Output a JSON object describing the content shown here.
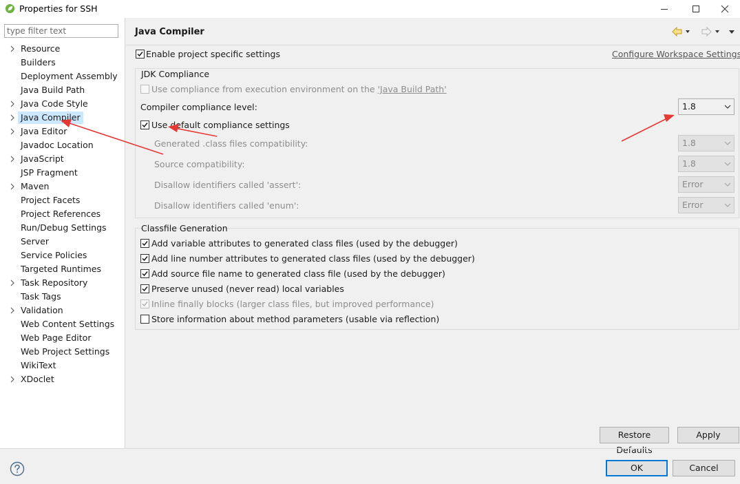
{
  "window": {
    "title": "Properties for SSH",
    "colors": {
      "accent": "#0078d7",
      "selection": "#cce8ff",
      "spring_green": "#6db33f",
      "annotation_red": "#e53935"
    }
  },
  "filter": {
    "placeholder": "type filter text",
    "value": ""
  },
  "tree": [
    {
      "label": "Resource",
      "expandable": true
    },
    {
      "label": "Builders",
      "expandable": false
    },
    {
      "label": "Deployment Assembly",
      "expandable": false
    },
    {
      "label": "Java Build Path",
      "expandable": false
    },
    {
      "label": "Java Code Style",
      "expandable": true
    },
    {
      "label": "Java Compiler",
      "expandable": true,
      "selected": true
    },
    {
      "label": "Java Editor",
      "expandable": true
    },
    {
      "label": "Javadoc Location",
      "expandable": false
    },
    {
      "label": "JavaScript",
      "expandable": true
    },
    {
      "label": "JSP Fragment",
      "expandable": false
    },
    {
      "label": "Maven",
      "expandable": true
    },
    {
      "label": "Project Facets",
      "expandable": false
    },
    {
      "label": "Project References",
      "expandable": false
    },
    {
      "label": "Run/Debug Settings",
      "expandable": false
    },
    {
      "label": "Server",
      "expandable": false
    },
    {
      "label": "Service Policies",
      "expandable": false
    },
    {
      "label": "Targeted Runtimes",
      "expandable": false
    },
    {
      "label": "Task Repository",
      "expandable": true
    },
    {
      "label": "Task Tags",
      "expandable": false
    },
    {
      "label": "Validation",
      "expandable": true
    },
    {
      "label": "Web Content Settings",
      "expandable": false
    },
    {
      "label": "Web Page Editor",
      "expandable": false
    },
    {
      "label": "Web Project Settings",
      "expandable": false
    },
    {
      "label": "WikiText",
      "expandable": false
    },
    {
      "label": "XDoclet",
      "expandable": true
    }
  ],
  "page": {
    "title": "Java Compiler",
    "enable_specific_label": "Enable project specific settings",
    "enable_specific_checked": true,
    "configure_link": "Configure Workspace Settings..."
  },
  "jdk": {
    "group_title": "JDK Compliance",
    "use_env_prefix": "Use compliance from execution environment on the ",
    "use_env_link": "'Java Build Path'",
    "use_env_checked": false,
    "compliance_label": "Compiler compliance level:",
    "compliance_value": "1.8",
    "use_default_label": "Use default compliance settings",
    "use_default_checked": true,
    "rows": [
      {
        "label": "Generated .class files compatibility:",
        "value": "1.8"
      },
      {
        "label": "Source compatibility:",
        "value": "1.8"
      },
      {
        "label": "Disallow identifiers called 'assert':",
        "value": "Error"
      },
      {
        "label": "Disallow identifiers called 'enum':",
        "value": "Error"
      }
    ]
  },
  "classfile": {
    "group_title": "Classfile Generation",
    "options": [
      {
        "label": "Add variable attributes to generated class files (used by the debugger)",
        "checked": true,
        "disabled": false
      },
      {
        "label": "Add line number attributes to generated class files (used by the debugger)",
        "checked": true,
        "disabled": false
      },
      {
        "label": "Add source file name to generated class file (used by the debugger)",
        "checked": true,
        "disabled": false
      },
      {
        "label": "Preserve unused (never read) local variables",
        "checked": true,
        "disabled": false
      },
      {
        "label": "Inline finally blocks (larger class files, but improved performance)",
        "checked": true,
        "disabled": true
      },
      {
        "label": "Store information about method parameters (usable via reflection)",
        "checked": false,
        "disabled": false
      }
    ]
  },
  "buttons": {
    "restore": "Restore Defaults",
    "apply": "Apply",
    "ok": "OK",
    "cancel": "Cancel"
  },
  "icons": {
    "app": "spring-leaf-icon",
    "help": "help-question-icon",
    "back": "back-arrow-icon",
    "forward": "forward-arrow-icon"
  }
}
